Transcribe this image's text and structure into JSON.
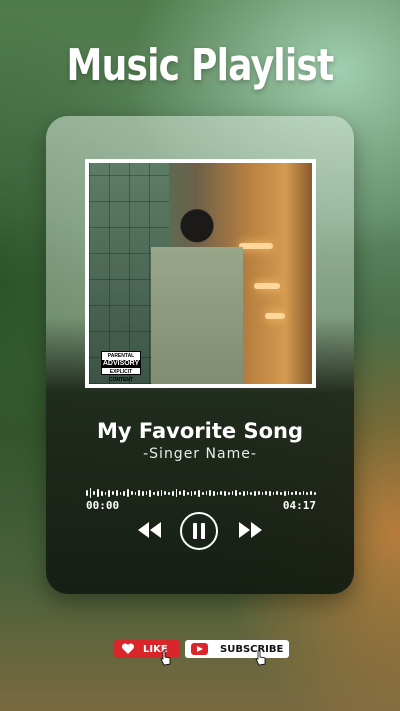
{
  "header": {
    "title": "Music Playlist"
  },
  "player": {
    "album_art": {
      "advisory_top": "PARENTAL",
      "advisory_main": "ADVISORY",
      "advisory_bottom": "EXPLICIT CONTENT"
    },
    "song_title": "My Favorite Song",
    "singer": "-Singer Name-",
    "time_elapsed": "00:00",
    "time_total": "04:17",
    "controls": {
      "prev_icon": "rewind-icon",
      "play_icon": "pause-icon",
      "next_icon": "fast-forward-icon"
    }
  },
  "actions": {
    "like_label": "LIKE",
    "subscribe_label": "SUBSCRIBE",
    "like_icon": "heart-icon",
    "subscribe_icon": "youtube-icon",
    "like_color": "#d9262a",
    "subscribe_color": "#ffffff"
  }
}
